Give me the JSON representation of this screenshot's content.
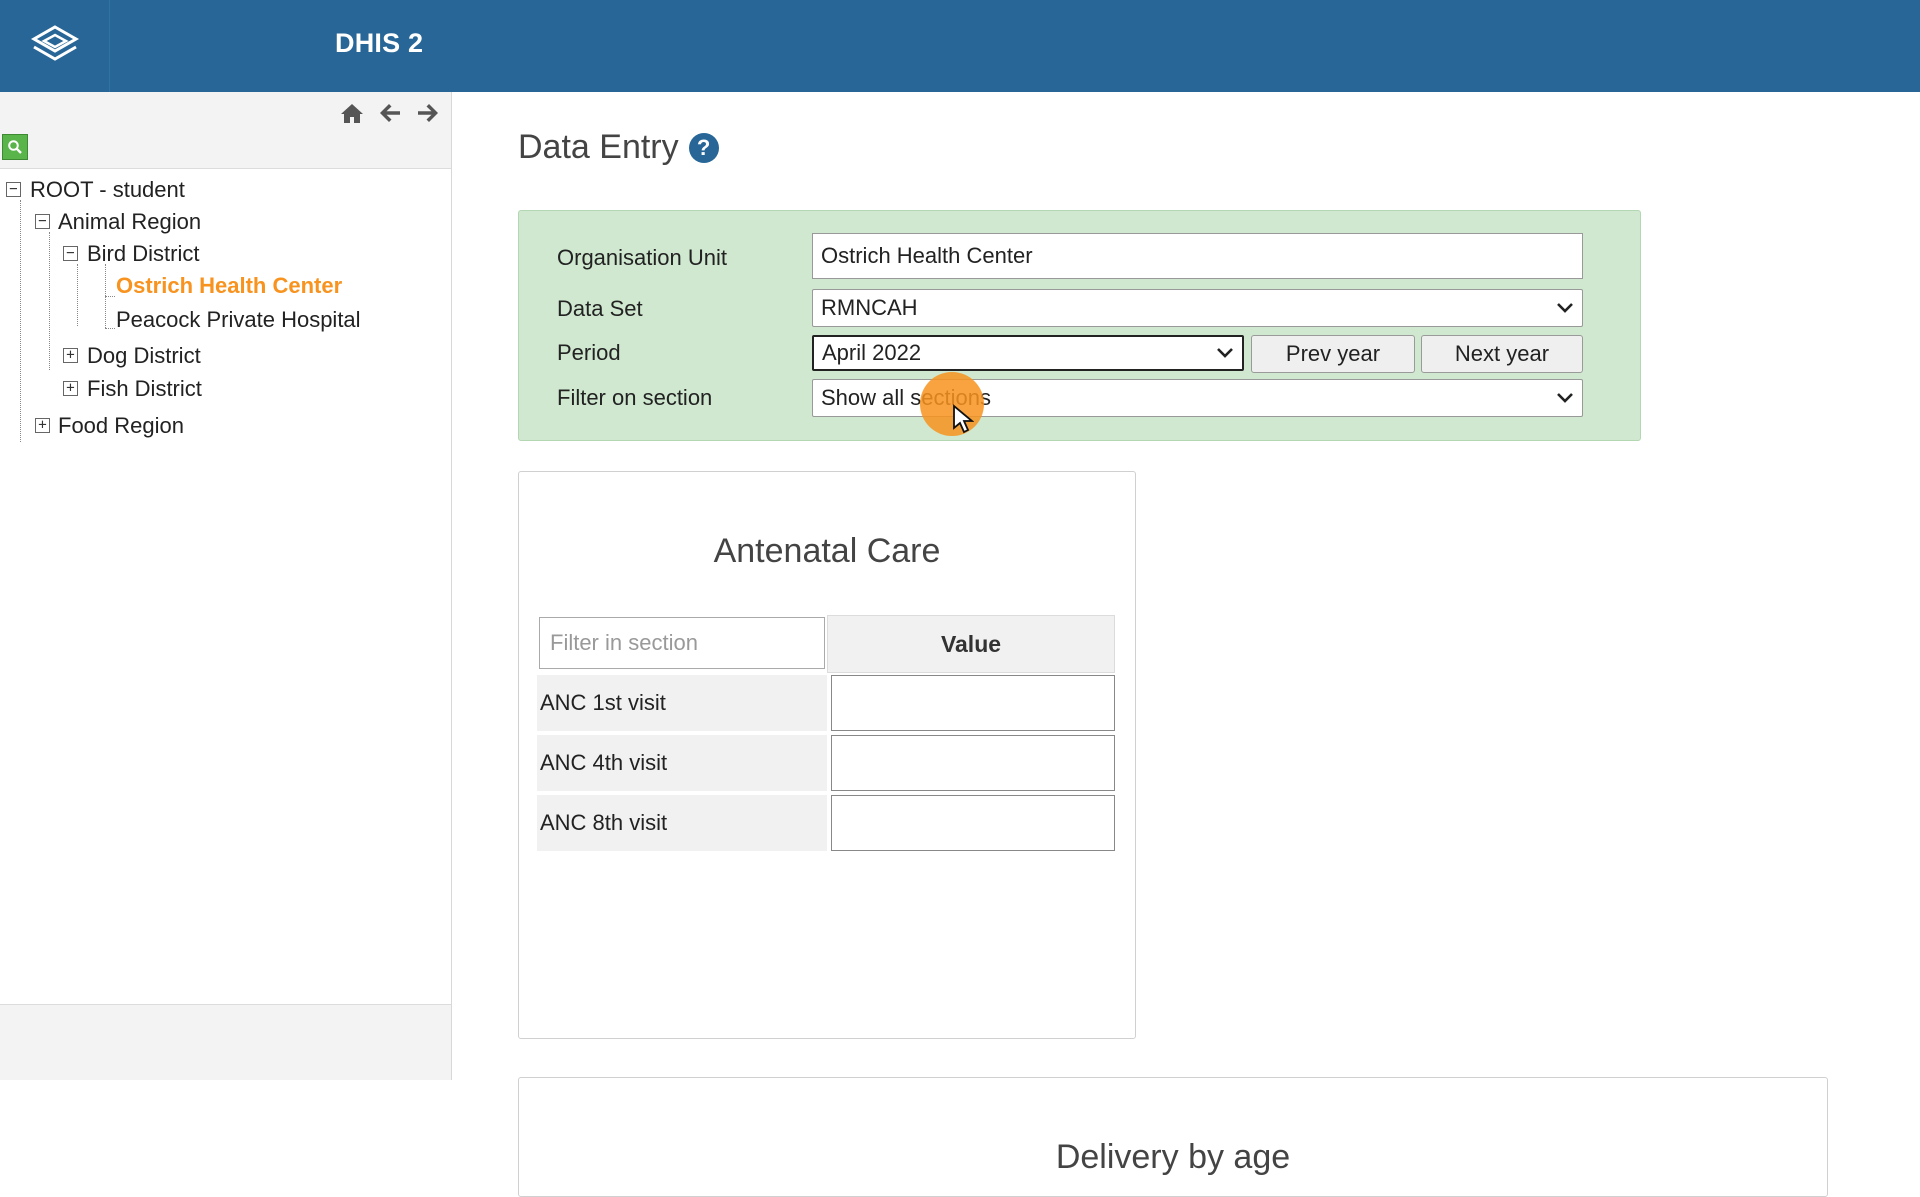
{
  "header": {
    "app_title": "DHIS 2",
    "logo_icon": "dhis2-logo-icon",
    "background": "#276696"
  },
  "sidebar": {
    "nav_icons": [
      "home-icon",
      "arrow-left-icon",
      "arrow-right-icon"
    ],
    "search_icon": "search-icon",
    "tree": [
      {
        "label": "ROOT - student",
        "expanded": true
      },
      {
        "label": "Animal Region",
        "expanded": true
      },
      {
        "label": "Bird District",
        "expanded": true
      },
      {
        "label": "Ostrich Health Center",
        "selected": true
      },
      {
        "label": "Peacock Private Hospital"
      },
      {
        "label": "Dog District",
        "expanded": false
      },
      {
        "label": "Fish District",
        "expanded": false
      },
      {
        "label": "Food Region",
        "expanded": false
      }
    ],
    "selected_color": "#f7931e"
  },
  "main": {
    "title": "Data Entry",
    "help_icon": "help-icon",
    "selection": {
      "org_unit_label": "Organisation Unit",
      "org_unit_value": "Ostrich Health Center",
      "data_set_label": "Data Set",
      "data_set_value": "RMNCAH",
      "period_label": "Period",
      "period_value": "April 2022",
      "prev_year": "Prev year",
      "next_year": "Next year",
      "filter_label": "Filter on section",
      "filter_value": "Show all sections",
      "background": "#cfe8cf"
    },
    "sections": [
      {
        "title": "Antenatal Care",
        "filter_placeholder": "Filter in section",
        "value_header": "Value",
        "rows": [
          {
            "label": "ANC 1st visit",
            "value": ""
          },
          {
            "label": "ANC 4th visit",
            "value": ""
          },
          {
            "label": "ANC 8th visit",
            "value": ""
          }
        ]
      },
      {
        "title": "Delivery by age"
      }
    ]
  }
}
